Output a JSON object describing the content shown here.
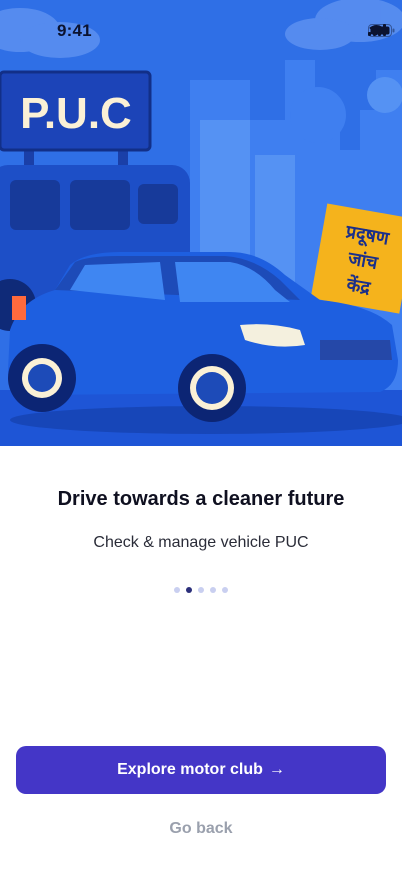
{
  "status_bar": {
    "time": "9:41"
  },
  "hero": {
    "sign_puc": "P.U.C",
    "sign_hindi_line1": "प्रदूषण",
    "sign_hindi_line2": "जांच",
    "sign_hindi_line3": "केंद्र"
  },
  "onboarding": {
    "title": "Drive towards a cleaner future",
    "subtitle": "Check & manage vehicle PUC",
    "page_count": 5,
    "active_page": 2
  },
  "actions": {
    "primary_label": "Explore motor club",
    "primary_arrow": "→",
    "secondary_label": "Go back"
  },
  "colors": {
    "sky": "#2f6fe6",
    "primary_button": "#4436c7",
    "sign_yellow": "#f5b31c"
  }
}
